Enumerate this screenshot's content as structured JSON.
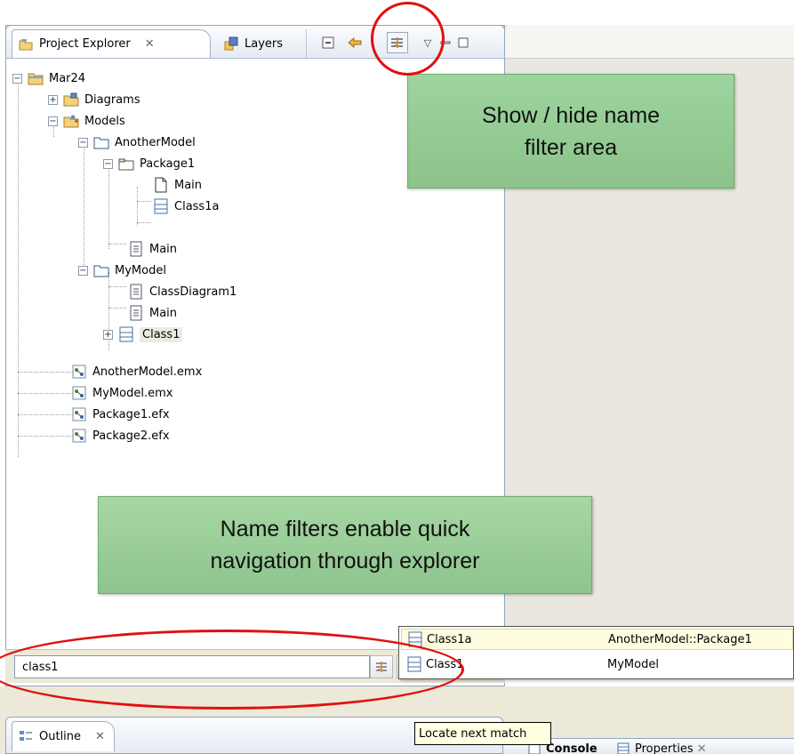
{
  "explorer": {
    "tab_active_label": "Project Explorer",
    "tab_inactive_label": "Layers",
    "tree": [
      {
        "label": "Mar24",
        "icon": "project-folder-icon",
        "level": 0,
        "expanded": true
      },
      {
        "label": "Diagrams",
        "icon": "diagrams-folder-icon",
        "level": 1,
        "expanded": false
      },
      {
        "label": "Models",
        "icon": "models-folder-icon",
        "level": 1,
        "expanded": true
      },
      {
        "label": "AnotherModel",
        "icon": "folder-icon",
        "level": 2,
        "expanded": true
      },
      {
        "label": "Package1",
        "icon": "package-icon",
        "level": 3,
        "expanded": true
      },
      {
        "label": "Main",
        "icon": "page-icon",
        "level": 4
      },
      {
        "label": "Class1a",
        "icon": "class-icon",
        "level": 4
      },
      {
        "label": "Main",
        "icon": "diagram-icon",
        "level": 3
      },
      {
        "label": "MyModel",
        "icon": "folder-icon",
        "level": 2,
        "expanded": true
      },
      {
        "label": "ClassDiagram1",
        "icon": "diagram-icon",
        "level": 3
      },
      {
        "label": "Main",
        "icon": "diagram-icon",
        "level": 3
      },
      {
        "label": "Class1",
        "icon": "class-icon",
        "level": 3,
        "expanded": false,
        "selected": true
      },
      {
        "label": "AnotherModel.emx",
        "icon": "emx-file-icon",
        "level": 1
      },
      {
        "label": "MyModel.emx",
        "icon": "emx-file-icon",
        "level": 1
      },
      {
        "label": "Package1.efx",
        "icon": "efx-file-icon",
        "level": 1
      },
      {
        "label": "Package2.efx",
        "icon": "efx-file-icon",
        "level": 1
      }
    ]
  },
  "callouts": {
    "top_line1": "Show / hide name",
    "top_line2": "filter area",
    "bottom_line1": "Name filters enable quick",
    "bottom_line2": "navigation through explorer"
  },
  "filter": {
    "value": "class1"
  },
  "matches": [
    {
      "name": "Class1a",
      "path": "AnotherModel::Package1"
    },
    {
      "name": "Class1",
      "path": "MyModel"
    }
  ],
  "tooltip": "Locate next match",
  "outline_tab_label": "Outline",
  "console_tab_label": "Console",
  "properties_tab_label": "Properties"
}
